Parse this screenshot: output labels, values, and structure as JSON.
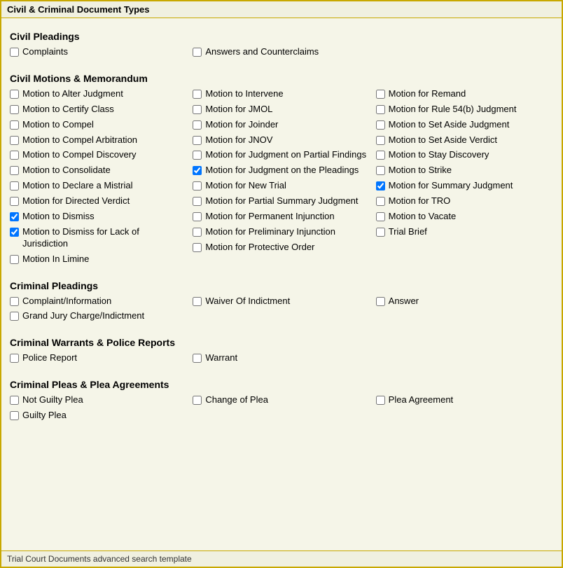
{
  "header": {
    "title": "Civil & Criminal Document Types"
  },
  "footer": {
    "text": "Trial Court Documents advanced search template"
  },
  "sections": [
    {
      "id": "civil-pleadings",
      "title": "Civil Pleadings",
      "columns": [
        [
          {
            "id": "complaints",
            "label": "Complaints",
            "checked": false
          }
        ],
        [
          {
            "id": "answers-counterclaims",
            "label": "Answers and Counterclaims",
            "checked": false
          }
        ],
        []
      ]
    },
    {
      "id": "civil-motions",
      "title": "Civil Motions & Memorandum",
      "columns": [
        [
          {
            "id": "motion-alter-judgment",
            "label": "Motion to Alter Judgment",
            "checked": false
          },
          {
            "id": "motion-certify-class",
            "label": "Motion to Certify Class",
            "checked": false
          },
          {
            "id": "motion-compel",
            "label": "Motion to Compel",
            "checked": false
          },
          {
            "id": "motion-compel-arbitration",
            "label": "Motion to Compel Arbitration",
            "checked": false
          },
          {
            "id": "motion-compel-discovery",
            "label": "Motion to Compel Discovery",
            "checked": false
          },
          {
            "id": "motion-consolidate",
            "label": "Motion to Consolidate",
            "checked": false
          },
          {
            "id": "motion-declare-mistrial",
            "label": "Motion to Declare a Mistrial",
            "checked": false
          },
          {
            "id": "motion-directed-verdict",
            "label": "Motion for Directed Verdict",
            "checked": false
          },
          {
            "id": "motion-dismiss",
            "label": "Motion to Dismiss",
            "checked": true
          },
          {
            "id": "motion-dismiss-lack-jurisdiction",
            "label": "Motion to Dismiss for Lack of Jurisdiction",
            "checked": true
          },
          {
            "id": "motion-in-limine",
            "label": "Motion In Limine",
            "checked": false
          }
        ],
        [
          {
            "id": "motion-intervene",
            "label": "Motion to Intervene",
            "checked": false
          },
          {
            "id": "motion-jmol",
            "label": "Motion for JMOL",
            "checked": false
          },
          {
            "id": "motion-joinder",
            "label": "Motion for Joinder",
            "checked": false
          },
          {
            "id": "motion-jnov",
            "label": "Motion for JNOV",
            "checked": false
          },
          {
            "id": "motion-judgment-partial-findings",
            "label": "Motion for Judgment on Partial Findings",
            "checked": false
          },
          {
            "id": "motion-judgment-pleadings",
            "label": "Motion for Judgment on the Pleadings",
            "checked": true
          },
          {
            "id": "motion-new-trial",
            "label": "Motion for New Trial",
            "checked": false
          },
          {
            "id": "motion-partial-summary-judgment",
            "label": "Motion for Partial Summary Judgment",
            "checked": false
          },
          {
            "id": "motion-permanent-injunction",
            "label": "Motion for Permanent Injunction",
            "checked": false
          },
          {
            "id": "motion-preliminary-injunction",
            "label": "Motion for Preliminary Injunction",
            "checked": false
          },
          {
            "id": "motion-protective-order",
            "label": "Motion for Protective Order",
            "checked": false
          }
        ],
        [
          {
            "id": "motion-remand",
            "label": "Motion for Remand",
            "checked": false
          },
          {
            "id": "motion-rule-54b-judgment",
            "label": "Motion for Rule 54(b) Judgment",
            "checked": false
          },
          {
            "id": "motion-set-aside-judgment",
            "label": "Motion to Set Aside Judgment",
            "checked": false
          },
          {
            "id": "motion-set-aside-verdict",
            "label": "Motion to Set Aside Verdict",
            "checked": false
          },
          {
            "id": "motion-stay-discovery",
            "label": "Motion to Stay Discovery",
            "checked": false
          },
          {
            "id": "motion-strike",
            "label": "Motion to Strike",
            "checked": false
          },
          {
            "id": "motion-summary-judgment",
            "label": "Motion for Summary Judgment",
            "checked": true
          },
          {
            "id": "motion-tro",
            "label": "Motion for TRO",
            "checked": false
          },
          {
            "id": "motion-vacate",
            "label": "Motion to Vacate",
            "checked": false
          },
          {
            "id": "trial-brief",
            "label": "Trial Brief",
            "checked": false
          }
        ]
      ]
    },
    {
      "id": "criminal-pleadings",
      "title": "Criminal Pleadings",
      "columns": [
        [
          {
            "id": "complaint-information",
            "label": "Complaint/Information",
            "checked": false
          },
          {
            "id": "grand-jury-charge-indictment",
            "label": "Grand Jury Charge/Indictment",
            "checked": false
          }
        ],
        [
          {
            "id": "waiver-of-indictment",
            "label": "Waiver Of Indictment",
            "checked": false
          }
        ],
        [
          {
            "id": "answer-criminal",
            "label": "Answer",
            "checked": false
          }
        ]
      ]
    },
    {
      "id": "criminal-warrants",
      "title": "Criminal Warrants & Police Reports",
      "columns": [
        [
          {
            "id": "police-report",
            "label": "Police Report",
            "checked": false
          }
        ],
        [
          {
            "id": "warrant",
            "label": "Warrant",
            "checked": false
          }
        ],
        []
      ]
    },
    {
      "id": "criminal-pleas",
      "title": "Criminal Pleas & Plea Agreements",
      "columns": [
        [
          {
            "id": "not-guilty-plea",
            "label": "Not Guilty Plea",
            "checked": false
          },
          {
            "id": "guilty-plea",
            "label": "Guilty Plea",
            "checked": false
          }
        ],
        [
          {
            "id": "change-of-plea",
            "label": "Change of Plea",
            "checked": false
          }
        ],
        [
          {
            "id": "plea-agreement",
            "label": "Plea Agreement",
            "checked": false
          }
        ]
      ]
    }
  ]
}
